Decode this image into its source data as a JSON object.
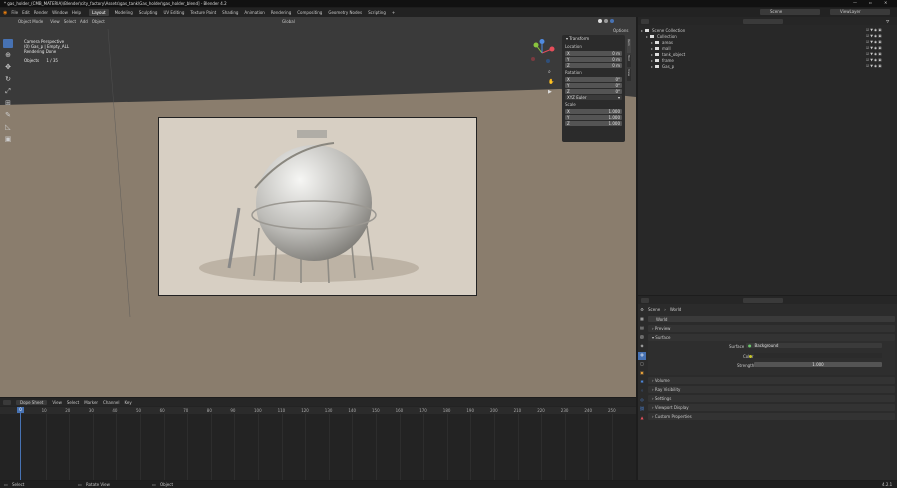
{
  "window": {
    "title": "* gas_holder_(CMB_MATERIA)\\Blender\\city_factory\\Assets\\gas_tank\\Gas_holder\\gas_holder_blend] - Blender 4.2"
  },
  "menu": [
    "File",
    "Edit",
    "Render",
    "Window",
    "Help"
  ],
  "workspaces": [
    "Layout",
    "Modeling",
    "Sculpting",
    "UV Editing",
    "Texture Paint",
    "Shading",
    "Animation",
    "Rendering",
    "Compositing",
    "Geometry Nodes",
    "Scripting",
    "+"
  ],
  "active_workspace": "Layout",
  "top_right": {
    "scene": "Scene",
    "view_layer": "ViewLayer"
  },
  "viewport": {
    "mode": "Object Mode",
    "menu": [
      "View",
      "Select",
      "Add",
      "Object"
    ],
    "transform_orientation": "Global",
    "options": "Options",
    "info": [
      "Camera Perspective",
      "(0) Gas_p | Empty_ALL",
      "Rendering Done"
    ],
    "objects_label": "Objects",
    "objects_value": "1 / 35"
  },
  "npanel": {
    "title": "Transform",
    "location_label": "Location",
    "location": [
      {
        "axis": "X",
        "value": "0 m"
      },
      {
        "axis": "Y",
        "value": "0 m"
      },
      {
        "axis": "Z",
        "value": "0 m"
      }
    ],
    "rotation_label": "Rotation",
    "rotation": [
      {
        "axis": "X",
        "value": "0°"
      },
      {
        "axis": "Y",
        "value": "0°"
      },
      {
        "axis": "Z",
        "value": "0°"
      }
    ],
    "rotation_mode": "XYZ Euler",
    "scale_label": "Scale",
    "scale": [
      {
        "axis": "X",
        "value": "1.000"
      },
      {
        "axis": "Y",
        "value": "1.000"
      },
      {
        "axis": "Z",
        "value": "1.000"
      }
    ],
    "tabs": [
      "Item",
      "Tool",
      "View"
    ]
  },
  "outliner": {
    "root": "Scene Collection",
    "items": [
      {
        "label": "Collection",
        "indent": 1
      },
      {
        "label": "areas",
        "indent": 2
      },
      {
        "label": "mall",
        "indent": 2
      },
      {
        "label": "tank_object",
        "indent": 2
      },
      {
        "label": "frame",
        "indent": 2
      },
      {
        "label": "Gas_p",
        "indent": 2
      }
    ]
  },
  "properties": {
    "breadcrumb": [
      "Scene",
      "World"
    ],
    "world_name": "World",
    "sections": {
      "preview": "Preview",
      "surface": "Surface",
      "volume": "Volume",
      "ray_visibility": "Ray Visibility",
      "settings": "Settings",
      "viewport_display": "Viewport Display",
      "custom_properties": "Custom Properties"
    },
    "surface_label": "Surface",
    "surface_value": "Background",
    "color_label": "Color",
    "strength_label": "Strength",
    "strength_value": "1.000"
  },
  "timeline": {
    "editor": "Dope Sheet",
    "menu": [
      "View",
      "Select",
      "Marker",
      "Channel",
      "Key"
    ],
    "current_frame": "0",
    "ticks": [
      "10",
      "20",
      "30",
      "40",
      "50",
      "60",
      "70",
      "80",
      "90",
      "100",
      "110",
      "120",
      "130",
      "140",
      "150",
      "160",
      "170",
      "180",
      "190",
      "200",
      "210",
      "220",
      "230",
      "240",
      "250"
    ]
  },
  "statusbar": {
    "left": "Select",
    "middle": "Rotate View",
    "right": "Object",
    "version": "4.2.1"
  },
  "colors": {
    "accent": "#4772b3",
    "bg": "#1d1d1d",
    "panel": "#303030",
    "header": "#262626"
  }
}
